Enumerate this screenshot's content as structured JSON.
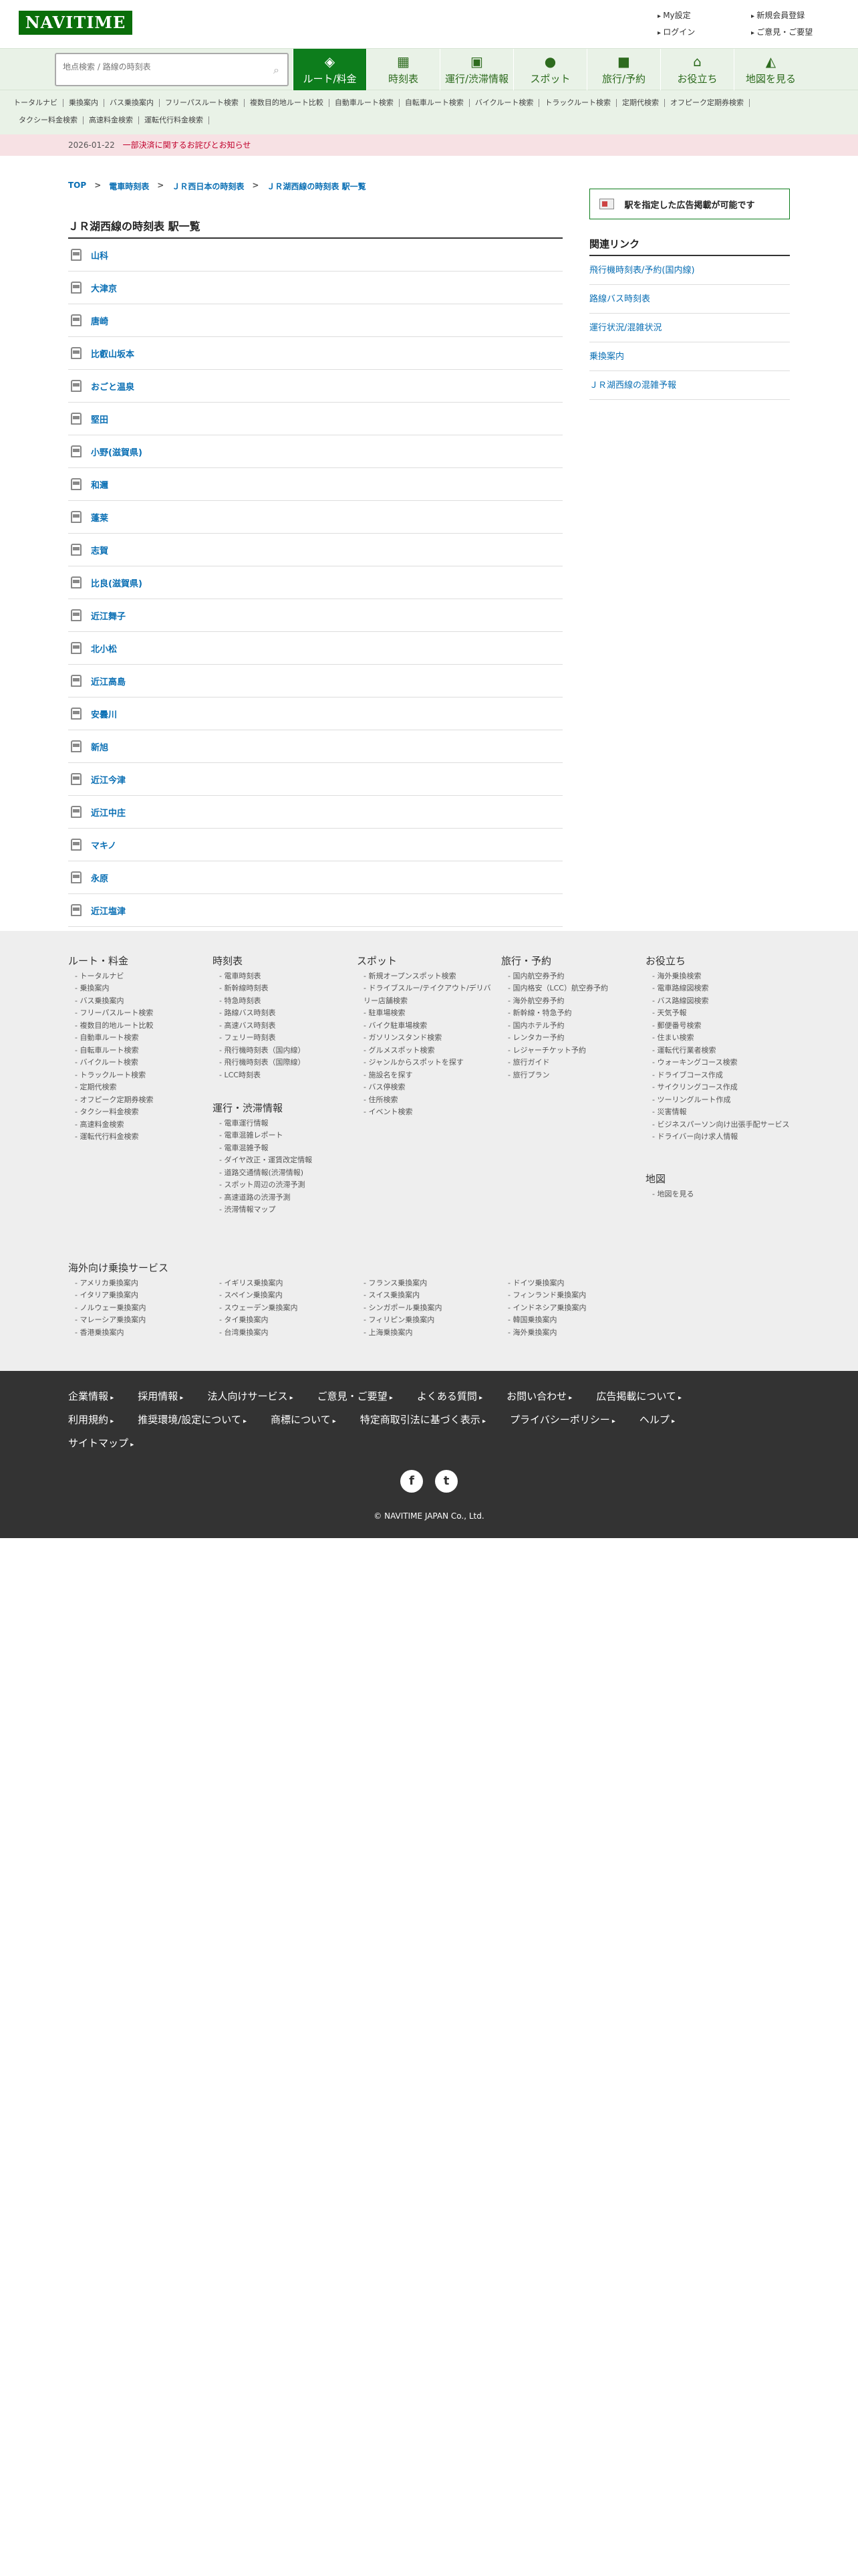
{
  "header": {
    "logo": "NAVITIME",
    "links": [
      "My設定",
      "新規会員登録",
      "ログイン",
      "ご意見・ご要望"
    ]
  },
  "search": {
    "placeholder": "地点検索 / 路線の時刻表"
  },
  "nav_tabs": [
    {
      "label": "ルート/料金",
      "icon": "cube-icon"
    },
    {
      "label": "時刻表",
      "icon": "calendar-icon"
    },
    {
      "label": "運行/渋滞情報",
      "icon": "train-car-icon"
    },
    {
      "label": "スポット",
      "icon": "pin-icon"
    },
    {
      "label": "旅行/予約",
      "icon": "suitcase-icon"
    },
    {
      "label": "お役立ち",
      "icon": "house-icon"
    },
    {
      "label": "地図を見る",
      "icon": "map-icon"
    }
  ],
  "subnav": [
    "トータルナビ",
    "乗換案内",
    "バス乗換案内",
    "フリーパスルート検索",
    "複数目的地ルート比較",
    "自動車ルート検索",
    "自転車ルート検索",
    "バイクルート検索",
    "トラックルート検索",
    "定期代検索",
    "オフピーク定期券検索",
    "タクシー料金検索",
    "高速料金検索",
    "運転代行料金検索"
  ],
  "notice": {
    "date": "2026-01-22",
    "text": "一部決済に関するお詫びとお知らせ"
  },
  "breadcrumb": [
    "TOP",
    "電車時刻表",
    "ＪＲ西日本の時刻表",
    "ＪＲ湖西線の時刻表 駅一覧"
  ],
  "page_title": "ＪＲ湖西線の時刻表 駅一覧",
  "stations": [
    "山科",
    "大津京",
    "唐崎",
    "比叡山坂本",
    "おごと温泉",
    "堅田",
    "小野(滋賀県)",
    "和邇",
    "蓬莱",
    "志賀",
    "比良(滋賀県)",
    "近江舞子",
    "北小松",
    "近江高島",
    "安曇川",
    "新旭",
    "近江今津",
    "近江中庄",
    "マキノ",
    "永原",
    "近江塩津"
  ],
  "sidebar": {
    "ad_button": "駅を指定した広告掲載が可能です",
    "related_title": "関連リンク",
    "related_links": [
      "飛行機時刻表/予約(国内線)",
      "路線バス時刻表",
      "運行状況/混雑状況",
      "乗換案内",
      "ＪＲ湖西線の混雑予報"
    ]
  },
  "footer": {
    "route": {
      "title": "ルート・料金",
      "items": [
        "トータルナビ",
        "乗換案内",
        "バス乗換案内",
        "フリーパスルート検索",
        "複数目的地ルート比較",
        "自動車ルート検索",
        "自転車ルート検索",
        "バイクルート検索",
        "トラックルート検索",
        "定期代検索",
        "オフピーク定期券検索",
        "タクシー料金検索",
        "高速料金検索",
        "運転代行料金検索"
      ]
    },
    "timetable": {
      "title": "時刻表",
      "items": [
        "電車時刻表",
        "新幹線時刻表",
        "特急時刻表",
        "路線バス時刻表",
        "高速バス時刻表",
        "フェリー時刻表",
        "飛行機時刻表（国内線）",
        "飛行機時刻表（国際線）",
        "LCC時刻表"
      ]
    },
    "operation": {
      "title": "運行・渋滞情報",
      "items": [
        "電車運行情報",
        "電車混雑レポート",
        "電車混雑予報",
        "ダイヤ改正・運賃改定情報",
        "道路交通情報(渋滞情報)",
        "スポット周辺の渋滞予測",
        "高速道路の渋滞予測",
        "渋滞情報マップ"
      ]
    },
    "spot": {
      "title": "スポット",
      "items": [
        "新規オープンスポット検索",
        "ドライブスルー/テイクアウト/デリバリー店舗検索",
        "駐車場検索",
        "バイク駐車場検索",
        "ガソリンスタンド検索",
        "グルメスポット検索",
        "ジャンルからスポットを探す",
        "施設名を探す",
        "バス停検索",
        "住所検索",
        "イベント検索"
      ]
    },
    "travel": {
      "title": "旅行・予約",
      "items": [
        "国内航空券予約",
        "国内格安（LCC）航空券予約",
        "海外航空券予約",
        "新幹線・特急予約",
        "国内ホテル予約",
        "レンタカー予約",
        "レジャーチケット予約",
        "旅行ガイド",
        "旅行プラン"
      ]
    },
    "useful": {
      "title": "お役立ち",
      "items": [
        "海外乗換検索",
        "電車路線図検索",
        "バス路線図検索",
        "天気予報",
        "郵便番号検索",
        "住まい検索",
        "運転代行業者検索",
        "ウォーキングコース検索",
        "ドライブコース作成",
        "サイクリングコース作成",
        "ツーリングルート作成",
        "災害情報",
        "ビジネスパーソン向け出張手配サービス",
        "ドライバー向け求人情報"
      ]
    },
    "map": {
      "title": "地図",
      "items": [
        "地図を見る"
      ]
    },
    "overseas": {
      "title": "海外向け乗換サービス",
      "items": [
        "アメリカ乗換案内",
        "イタリア乗換案内",
        "ノルウェー乗換案内",
        "マレーシア乗換案内",
        "香港乗換案内",
        "イギリス乗換案内",
        "スペイン乗換案内",
        "スウェーデン乗換案内",
        "タイ乗換案内",
        "台湾乗換案内",
        "フランス乗換案内",
        "スイス乗換案内",
        "シンガポール乗換案内",
        "フィリピン乗換案内",
        "上海乗換案内",
        "ドイツ乗換案内",
        "フィンランド乗換案内",
        "インドネシア乗換案内",
        "韓国乗換案内",
        "海外乗換案内"
      ]
    }
  },
  "bottom_links": [
    "企業情報",
    "採用情報",
    "法人向けサービス",
    "ご意見・ご要望",
    "よくある質問",
    "お問い合わせ",
    "広告掲載について",
    "利用規約",
    "推奨環境/設定について",
    "商標について",
    "特定商取引法に基づく表示",
    "プライバシーポリシー",
    "ヘルプ",
    "サイトマップ"
  ],
  "social": {
    "facebook": "f",
    "twitter": "t"
  },
  "copyright": "© NAVITIME JAPAN Co., Ltd."
}
